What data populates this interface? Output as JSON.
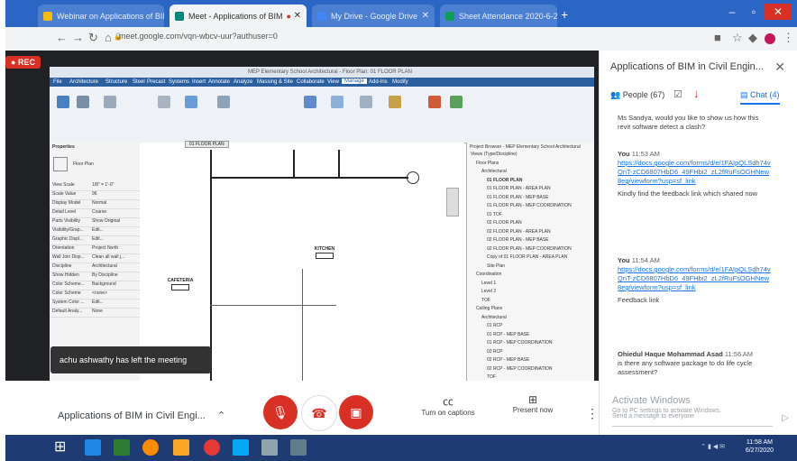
{
  "browser": {
    "tabs": [
      {
        "label": "Webinar on Applications of BIM",
        "color": "#fbbc05",
        "active": false
      },
      {
        "label": "Meet - Applications of BIM",
        "color": "#00897b",
        "active": true
      },
      {
        "label": "My Drive - Google Drive",
        "color": "#4285f4",
        "active": false
      },
      {
        "label": "Sheet Attendance 2020-6-27 11:",
        "color": "#0f9d58",
        "active": false
      }
    ],
    "new_tab": "+",
    "url": "meet.google.com/vqn-wbcv-uur?authuser=0",
    "nav_icons": [
      "back-icon",
      "forward-icon",
      "reload-icon",
      "home-icon"
    ]
  },
  "meet": {
    "rec_label": "REC",
    "toast": "achu ashwathy has left the meeting",
    "meeting_name": "Applications of BIM in Civil Engi...",
    "captions_label": "Turn on captions",
    "present_label": "Present now"
  },
  "revit": {
    "title": "MEP Elementary School Architectural - Floor Plan: 01 FLOOR PLAN",
    "ribbon_tabs": [
      "File",
      "Architecture",
      "Structure",
      "Steel",
      "Precast",
      "Systems",
      "Insert",
      "Annotate",
      "Analyze",
      "Massing & Site",
      "Collaborate",
      "View",
      "Manage",
      "Add-Ins",
      "Modify"
    ],
    "view_tab": "01 FLOOR PLAN",
    "properties_title": "Properties",
    "properties_type": "Floor Plan",
    "properties_rows": [
      [
        "View Scale",
        "1/8\" = 1'-0\""
      ],
      [
        "Scale Value",
        "96"
      ],
      [
        "Display Model",
        "Normal"
      ],
      [
        "Detail Level",
        "Coarse"
      ],
      [
        "Parts Visibility",
        "Show Original"
      ],
      [
        "Visibility/Grap...",
        "Edit..."
      ],
      [
        "Graphic Displ...",
        "Edit..."
      ],
      [
        "Orientation",
        "Project North"
      ],
      [
        "Wall Join Disp...",
        "Clean all wall j..."
      ],
      [
        "Discipline",
        "Architectural"
      ],
      [
        "Show Hidden",
        "By Discipline"
      ],
      [
        "Color Scheme...",
        "Background"
      ],
      [
        "Color Scheme",
        "<none>"
      ],
      [
        "System Color ...",
        "Edit..."
      ],
      [
        "Default Analy...",
        "None"
      ]
    ],
    "browser_title": "Project Browser - MEP Elementary School Architectural",
    "browser_items": [
      "Views (Type/Discipline)",
      "Floor Plans",
      "Architectural",
      "01 FLOOR PLAN",
      "01 FLOOR PLAN - AREA PLAN",
      "01 FLOOR PLAN - MEP BASE",
      "01 FLOOR PLAN - MEP COORDINATION",
      "01 TOF",
      "02 FLOOR PLAN",
      "02 FLOOR PLAN - AREA PLAN",
      "02 FLOOR PLAN - MEP BASE",
      "02 FLOOR PLAN - MEP COORDINATION",
      "Copy of 01 FLOOR PLAN - AREA PLAN",
      "Site Plan",
      "Coordination",
      "Level 1",
      "Level 2",
      "TOF",
      "Ceiling Plans",
      "Architectural",
      "01 RCP",
      "01 RCP - MEP BASE",
      "01 RCP - MEP COORDINATION",
      "02 RCP",
      "02 RCP - MEP BASE",
      "02 RCP - MEP COORDINATION",
      "TOF"
    ],
    "rooms": [
      {
        "name": "CAFETERIA"
      },
      {
        "name": "KITCHEN"
      }
    ]
  },
  "chat": {
    "title": "Applications of BIM in Civil Engin...",
    "people_label": "People (67)",
    "chat_label": "Chat (4)",
    "messages": [
      {
        "who": "",
        "time": "",
        "text": "Ms Sandya, would you like to show us how this revit software detect a clash?",
        "link": ""
      },
      {
        "who": "You",
        "time": "11:53 AM",
        "text": "Kindly find the feedback link which shared now",
        "link": "https://docs.google.com/forms/d/e/1FAIpQLSdh74vQnT-zCD6807HbD6_49FHbi2_zL2fRuFsOGHNew8eg/viewform?usp=sf_link"
      },
      {
        "who": "You",
        "time": "11:54 AM",
        "text": "Feedback link",
        "link": "https://docs.google.com/forms/d/e/1FAIpQLSdh74vQnT-zCD6807HbD6_49FHbi2_zL2fRuFsOGHNew8eg/viewform?usp=sf_link"
      },
      {
        "who": "Ohiedul Haque Mohammad Asad",
        "time": "11:56 AM",
        "text": "is there any software package to do life cycle assessment?",
        "link": ""
      }
    ],
    "watermark": "Activate Windows",
    "watermark_sub": "Go to PC settings to activate Windows.",
    "input_placeholder": "Send a message to everyone"
  },
  "taskbar": {
    "time": "11:58 AM",
    "date": "6/27/2020"
  }
}
